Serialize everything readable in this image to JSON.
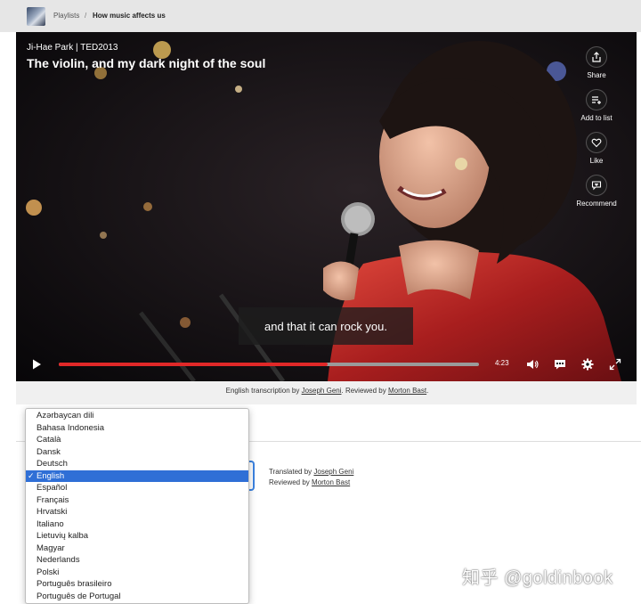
{
  "breadcrumb": {
    "playlists": "Playlists",
    "separator": "/",
    "current": "How music affects us"
  },
  "video": {
    "speaker_event": "Ji-Hae Park | TED2013",
    "title": "The violin, and my dark night of the soul",
    "subtitle": "and that it can rock you.",
    "time_remaining": "4:23",
    "progress_fraction": 0.64,
    "accent_color": "#e02828"
  },
  "side_actions": [
    {
      "icon": "share-icon",
      "label": "Share"
    },
    {
      "icon": "add-to-list-icon",
      "label": "Add to list"
    },
    {
      "icon": "heart-icon",
      "label": "Like"
    },
    {
      "icon": "recommend-icon",
      "label": "Recommend"
    }
  ],
  "controls": {
    "icons": [
      "play-icon",
      "volume-icon",
      "subtitles-icon",
      "settings-gear-icon",
      "fullscreen-icon"
    ]
  },
  "credits": {
    "prefix": "English transcription by ",
    "transcriber": "Joseph Geni",
    "middle": ". Reviewed by ",
    "reviewer": "Morton Bast",
    "suffix": "."
  },
  "translation": {
    "translated_prefix": "Translated by ",
    "translator": "Joseph Geni",
    "reviewed_prefix": "Reviewed by ",
    "reviewer": "Morton Bast"
  },
  "language_dropdown": {
    "selected": "English",
    "options": [
      "Azərbaycan dili",
      "Bahasa Indonesia",
      "Català",
      "Dansk",
      "Deutsch",
      "English",
      "Español",
      "Français",
      "Hrvatski",
      "Italiano",
      "Lietuvių kalba",
      "Magyar",
      "Nederlands",
      "Polski",
      "Português brasileiro",
      "Português de Portugal"
    ]
  },
  "watermark": "知乎 @goldinbook"
}
